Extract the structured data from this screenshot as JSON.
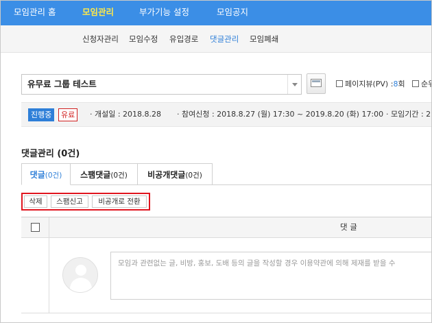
{
  "nav": {
    "items": [
      {
        "label": "모임관리 홈"
      },
      {
        "label": "모임관리"
      },
      {
        "label": "부가기능 설정"
      },
      {
        "label": "모임공지"
      }
    ],
    "active_color": "#ffe94a",
    "bg_color": "#3b8ee6"
  },
  "subnav": {
    "items": [
      {
        "label": "신청자관리"
      },
      {
        "label": "모임수정"
      },
      {
        "label": "유입경로"
      },
      {
        "label": "댓글관리"
      },
      {
        "label": "모임폐쇄"
      }
    ],
    "active_color": "#2e7fd8"
  },
  "group": {
    "selected": "유무료 그룹 테스트",
    "pageview_label": "페이지뷰(PV) :",
    "pageview_value": "8",
    "pageview_unit": "회",
    "rank_label": "순위"
  },
  "info": {
    "status_badge": "진행중",
    "paid_badge": "유료",
    "open_date": "· 개설일 : 2018.8.28",
    "apply_period": "· 참여신청 : 2018.8.27 (월) 17:30 ~ 2019.8.20 (화) 17:00",
    "meet_period": "· 모임기간 : 2"
  },
  "section": {
    "title": "댓글관리 (0건)"
  },
  "tabs": [
    {
      "label": "댓글",
      "count": "(0건)"
    },
    {
      "label": "스팸댓글",
      "count": "(0건)"
    },
    {
      "label": "비공개댓글",
      "count": "(0건)"
    }
  ],
  "actions": {
    "delete": "삭제",
    "report_spam": "스팸신고",
    "make_private": "비공개로 전환"
  },
  "table": {
    "column_comment": "댓 글",
    "comment_placeholder": "모임과 관련없는 글, 비방, 홍보, 도배 등의 글을 작성할 경우 이용약관에 의해 제재를 받을 수"
  }
}
